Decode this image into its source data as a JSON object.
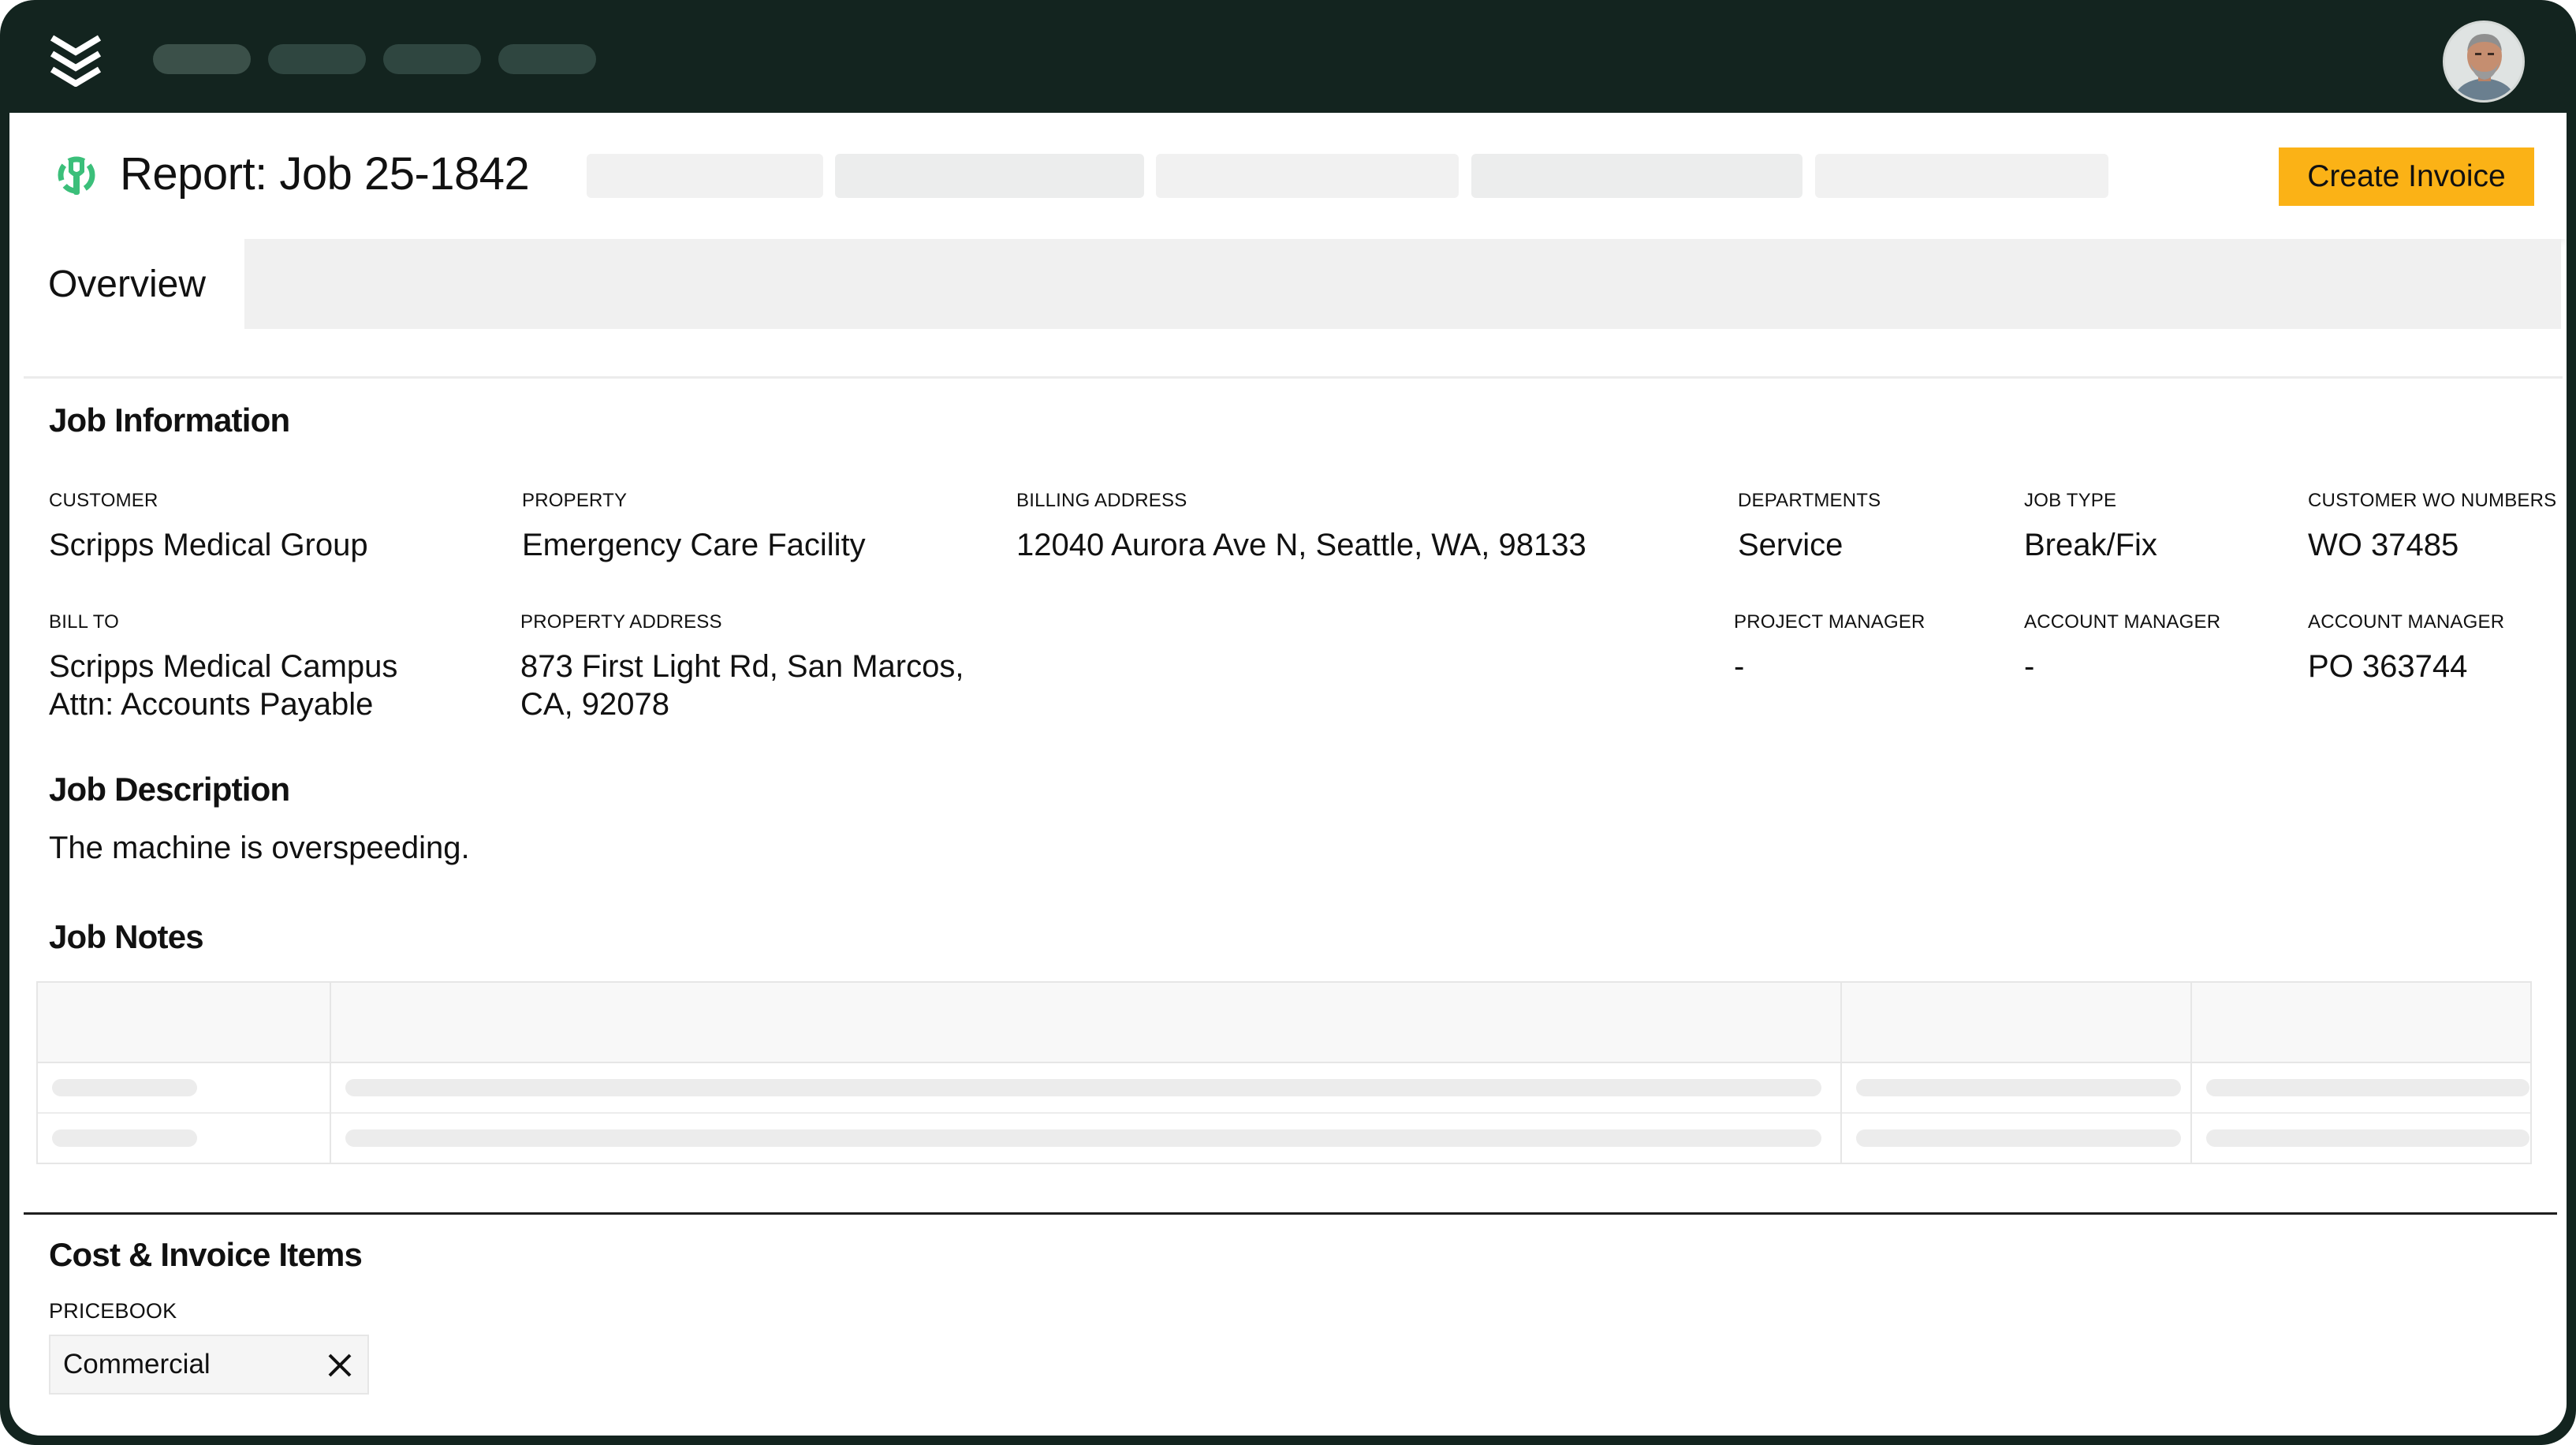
{
  "header": {
    "title": "Report: Job 25-1842",
    "create_invoice_label": "Create Invoice"
  },
  "tabs": [
    {
      "label": "Overview",
      "active": true
    }
  ],
  "job_information": {
    "heading": "Job Information",
    "fields": {
      "customer": {
        "label": "CUSTOMER",
        "value": "Scripps Medical Group"
      },
      "property": {
        "label": "PROPERTY",
        "value": "Emergency Care Facility"
      },
      "billing_address": {
        "label": "BILLING ADDRESS",
        "value": "12040 Aurora Ave N, Seattle, WA, 98133"
      },
      "departments": {
        "label": "DEPARTMENTS",
        "value": "Service"
      },
      "job_type": {
        "label": "JOB TYPE",
        "value": "Break/Fix"
      },
      "customer_wo_numbers": {
        "label": "CUSTOMER WO NUMBERS",
        "value": "WO 37485"
      },
      "bill_to": {
        "label": "BILL TO",
        "line1": "Scripps Medical Campus",
        "line2": "Attn: Accounts Payable"
      },
      "property_address": {
        "label": "PROPERTY ADDRESS",
        "line1": "873 First Light Rd, San Marcos,",
        "line2": "CA, 92078"
      },
      "project_manager": {
        "label": "PROJECT MANAGER",
        "value": "-"
      },
      "account_manager": {
        "label": "ACCOUNT MANAGER",
        "value": "-"
      },
      "account_manager_po": {
        "label": "ACCOUNT MANAGER",
        "value": "PO 363744"
      }
    }
  },
  "job_description": {
    "heading": "Job Description",
    "text": "The machine is overspeeding."
  },
  "job_notes": {
    "heading": "Job Notes"
  },
  "cost_invoice": {
    "heading": "Cost & Invoice Items",
    "pricebook_label": "PRICEBOOK",
    "pricebook_value": "Commercial"
  },
  "icons": {
    "logo": "stacked-chevrons-logo-icon",
    "job": "wrench-gear-icon",
    "clear": "close-icon"
  },
  "colors": {
    "topbar": "#13241f",
    "accent_button": "#fbb216",
    "job_icon": "#3bbf7a"
  }
}
